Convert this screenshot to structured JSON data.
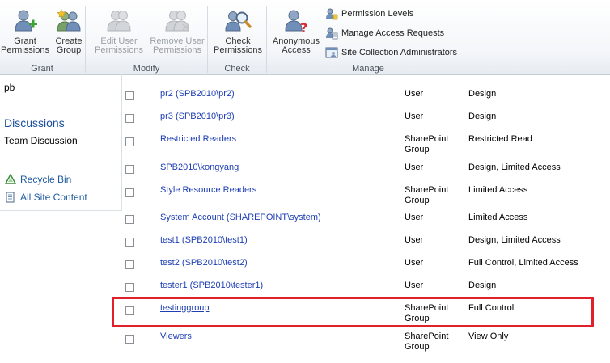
{
  "ribbon": {
    "grant": {
      "label": "Grant",
      "grant_permissions": "Grant\nPermissions",
      "create_group": "Create\nGroup"
    },
    "modify": {
      "label": "Modify",
      "edit_user_permissions": "Edit User\nPermissions",
      "remove_user_permissions": "Remove User\nPermissions"
    },
    "check": {
      "label": "Check",
      "check_permissions": "Check\nPermissions"
    },
    "manage": {
      "label": "Manage",
      "anonymous_access": "Anonymous\nAccess",
      "permission_levels": "Permission Levels",
      "manage_access_requests": "Manage Access Requests",
      "site_collection_administrators": "Site Collection Administrators"
    }
  },
  "leftnav": {
    "item_pb": "pb",
    "discussions_heading": "Discussions",
    "team_discussion": "Team Discussion",
    "recycle_bin": "Recycle Bin",
    "all_site_content": "All Site Content"
  },
  "rows": [
    {
      "name": "pr2 (SPB2010\\pr2)",
      "type": "User",
      "perm": "Design"
    },
    {
      "name": "pr3 (SPB2010\\pr3)",
      "type": "User",
      "perm": "Design"
    },
    {
      "name": "Restricted Readers",
      "type": "SharePoint\nGroup",
      "perm": "Restricted Read"
    },
    {
      "name": "SPB2010\\kongyang",
      "type": "User",
      "perm": "Design, Limited Access"
    },
    {
      "name": "Style Resource Readers",
      "type": "SharePoint\nGroup",
      "perm": "Limited Access"
    },
    {
      "name": "System Account (SHAREPOINT\\system)",
      "type": "User",
      "perm": "Limited Access"
    },
    {
      "name": "test1 (SPB2010\\test1)",
      "type": "User",
      "perm": "Design, Limited Access"
    },
    {
      "name": "test2 (SPB2010\\test2)",
      "type": "User",
      "perm": "Full Control, Limited Access"
    },
    {
      "name": "tester1 (SPB2010\\tester1)",
      "type": "User",
      "perm": "Design"
    },
    {
      "name": "testinggroup",
      "type": "SharePoint\nGroup",
      "perm": "Full Control"
    },
    {
      "name": "Viewers",
      "type": "SharePoint\nGroup",
      "perm": "View Only"
    }
  ],
  "colors": {
    "highlight": "#e0202a",
    "link": "#1f3fb5",
    "nav_heading": "#1b4f9c"
  }
}
